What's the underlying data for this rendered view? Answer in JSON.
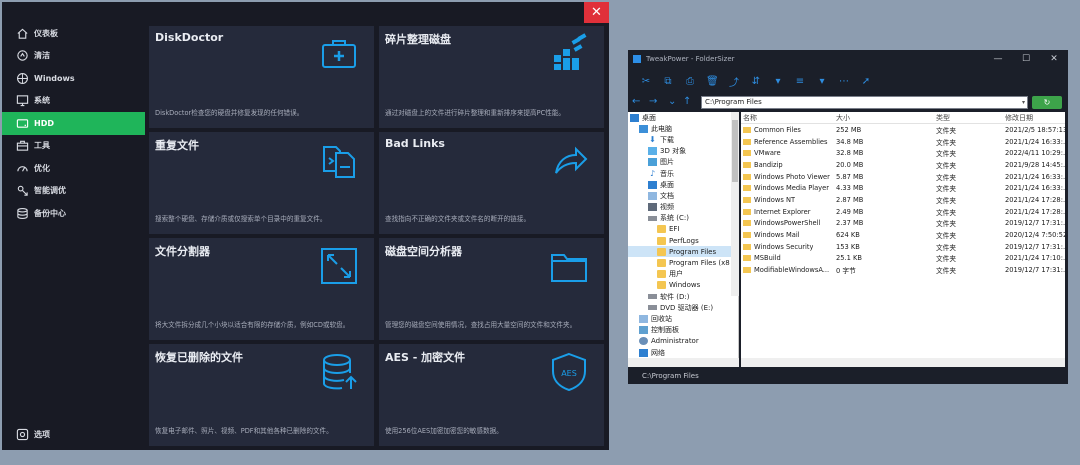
{
  "main_app": {
    "close_glyph": "✕",
    "nav": [
      {
        "label": "仪表板",
        "icon": "home-icon"
      },
      {
        "label": "清洁",
        "icon": "clean-icon"
      },
      {
        "label": "Windows",
        "icon": "windows-icon"
      },
      {
        "label": "系统",
        "icon": "monitor-icon"
      },
      {
        "label": "HDD",
        "icon": "hdd-icon"
      },
      {
        "label": "工具",
        "icon": "toolbox-icon"
      },
      {
        "label": "优化",
        "icon": "gauge-icon"
      },
      {
        "label": "智能调优",
        "icon": "smart-tune-icon"
      },
      {
        "label": "备份中心",
        "icon": "backup-icon"
      }
    ],
    "active_nav": "HDD",
    "options_label": "选项",
    "cards": [
      {
        "title": "DiskDoctor",
        "desc": "DiskDoctor检查您的硬盘并修复发现的任何错误。",
        "icon": "medkit-icon"
      },
      {
        "title": "碎片整理磁盘",
        "desc": "通过对磁盘上的文件进行碎片整理和重新排序来提高PC性能。",
        "icon": "defrag-icon"
      },
      {
        "title": "重复文件",
        "desc": "搜索整个硬盘、存储介质或仅搜索单个目录中的重复文件。",
        "icon": "duplicate-files-icon"
      },
      {
        "title": "Bad Links",
        "desc": "查找指向不正确的文件夹或文件名的断开的链接。",
        "icon": "share-arrow-icon"
      },
      {
        "title": "文件分割器",
        "desc": "将大文件拆分成几个小块以适合有限的存储介质，例如CD或软盘。",
        "icon": "file-split-icon"
      },
      {
        "title": "磁盘空间分析器",
        "desc": "管理您的磁盘空间使用情况，查找占用大量空间的文件和文件夹。",
        "icon": "folder-icon"
      },
      {
        "title": "恢复已删除的文件",
        "desc": "恢复电子邮件、照片、视频、PDF和其他各种已删除的文件。",
        "icon": "database-restore-icon"
      },
      {
        "title": "AES - 加密文件",
        "desc": "使用256位AES加密加密您的敏感数据。",
        "icon": "aes-shield-icon",
        "icon_text": "AES"
      }
    ],
    "accent": "#1fb55a",
    "icon_color": "#1a9ee8"
  },
  "folder_sizer": {
    "title": "TweakPower - FolderSizer",
    "win_buttons": [
      "—",
      "☐",
      "✕"
    ],
    "toolbar": [
      "✂",
      "⧉",
      "⎙",
      "🗑",
      "⤴",
      "⇵",
      "▾",
      "≡",
      "▾",
      "⋯",
      "➚"
    ],
    "nav_arrows": [
      "←",
      "→",
      "⌄",
      "↑"
    ],
    "address": "C:\\Program Files",
    "go_glyph": "↻",
    "tree": [
      {
        "label": "桌面",
        "indent": 0,
        "icon": "desk"
      },
      {
        "label": "此电脑",
        "indent": 1,
        "icon": "pc"
      },
      {
        "label": "下载",
        "indent": 2,
        "icon": "dl"
      },
      {
        "label": "3D 对象",
        "indent": 2,
        "icon": "cube"
      },
      {
        "label": "图片",
        "indent": 2,
        "icon": "pic"
      },
      {
        "label": "音乐",
        "indent": 2,
        "icon": "mus"
      },
      {
        "label": "桌面",
        "indent": 2,
        "icon": "desk"
      },
      {
        "label": "文档",
        "indent": 2,
        "icon": "doc"
      },
      {
        "label": "视频",
        "indent": 2,
        "icon": "vid"
      },
      {
        "label": "系统 (C:)",
        "indent": 2,
        "icon": "drive"
      },
      {
        "label": "EFI",
        "indent": 3,
        "icon": "folder"
      },
      {
        "label": "PerfLogs",
        "indent": 3,
        "icon": "folder"
      },
      {
        "label": "Program Files",
        "indent": 3,
        "icon": "folder",
        "selected": true
      },
      {
        "label": "Program Files (x8",
        "indent": 3,
        "icon": "folder"
      },
      {
        "label": "用户",
        "indent": 3,
        "icon": "folder"
      },
      {
        "label": "Windows",
        "indent": 3,
        "icon": "folder"
      },
      {
        "label": "软件 (D:)",
        "indent": 2,
        "icon": "drive"
      },
      {
        "label": "DVD 驱动器 (E:)",
        "indent": 2,
        "icon": "drive"
      },
      {
        "label": "回收站",
        "indent": 1,
        "icon": "doc"
      },
      {
        "label": "控制面板",
        "indent": 1,
        "icon": "cp"
      },
      {
        "label": "Administrator",
        "indent": 1,
        "icon": "person"
      },
      {
        "label": "网络",
        "indent": 1,
        "icon": "net"
      }
    ],
    "columns": {
      "name": "名称",
      "size": "大小",
      "type": "类型",
      "date": "修改日期"
    },
    "rows": [
      {
        "name": "Common Files",
        "size": "252 MB",
        "type": "文件夹",
        "date": "2021/2/5 18:57:13"
      },
      {
        "name": "Reference Assemblies",
        "size": "34.8 MB",
        "type": "文件夹",
        "date": "2021/1/24 16:33:..."
      },
      {
        "name": "VMware",
        "size": "32.8 MB",
        "type": "文件夹",
        "date": "2022/4/11 10:29:..."
      },
      {
        "name": "Bandizip",
        "size": "20.0 MB",
        "type": "文件夹",
        "date": "2021/9/28 14:45:..."
      },
      {
        "name": "Windows Photo Viewer",
        "size": "5.87 MB",
        "type": "文件夹",
        "date": "2021/1/24 16:33:..."
      },
      {
        "name": "Windows Media Player",
        "size": "4.33 MB",
        "type": "文件夹",
        "date": "2021/1/24 16:33:..."
      },
      {
        "name": "Windows NT",
        "size": "2.87 MB",
        "type": "文件夹",
        "date": "2021/1/24 17:28:..."
      },
      {
        "name": "Internet Explorer",
        "size": "2.49 MB",
        "type": "文件夹",
        "date": "2021/1/24 17:28:..."
      },
      {
        "name": "WindowsPowerShell",
        "size": "2.37 MB",
        "type": "文件夹",
        "date": "2019/12/7 17:31:..."
      },
      {
        "name": "Windows Mail",
        "size": "624 KB",
        "type": "文件夹",
        "date": "2020/12/4 7:50:52"
      },
      {
        "name": "Windows Security",
        "size": "153 KB",
        "type": "文件夹",
        "date": "2019/12/7 17:31:..."
      },
      {
        "name": "MSBuild",
        "size": "25.1 KB",
        "type": "文件夹",
        "date": "2021/1/24 17:10:..."
      },
      {
        "name": "ModifiableWindowsA...",
        "size": "0 字节",
        "type": "文件夹",
        "date": "2019/12/7 17:31:..."
      }
    ],
    "status": "C:\\Program Files"
  }
}
